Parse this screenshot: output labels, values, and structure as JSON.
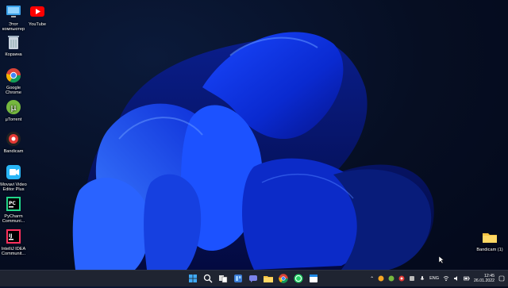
{
  "desktop": {
    "icons": [
      {
        "name": "this-computer-icon",
        "label": "Этот\nкомпьютер"
      },
      {
        "name": "youtube-icon",
        "label": "YouTube"
      },
      {
        "name": "recycle-bin-icon",
        "label": "Корзина"
      },
      {
        "name": "google-chrome-icon",
        "label": "Google\nChrome"
      },
      {
        "name": "utorrent-icon",
        "label": "µTorrent"
      },
      {
        "name": "bandicam-icon",
        "label": "Bandicam"
      },
      {
        "name": "movavi-video-editor-icon",
        "label": "Movavi Video\nEditor Plus"
      },
      {
        "name": "pycharm-icon",
        "label": "PyCharm\nCommuni..."
      },
      {
        "name": "intellij-idea-icon",
        "label": "IntelliJ IDEA\nCommunit..."
      },
      {
        "name": "bandicam-folder-icon",
        "label": "Bandicam (1)"
      }
    ]
  },
  "taskbar": {
    "apps": [
      "start-button",
      "search-button",
      "task-view-button",
      "widgets-button",
      "teams-chat-button",
      "file-explorer-button",
      "chrome-button",
      "whatsapp-button",
      "calendar-app-button"
    ],
    "language": "ENG",
    "time": "12:45",
    "date": "26.01.2022"
  },
  "colors": {
    "accent": "#2a5cff",
    "taskbar": "#1f2431"
  }
}
